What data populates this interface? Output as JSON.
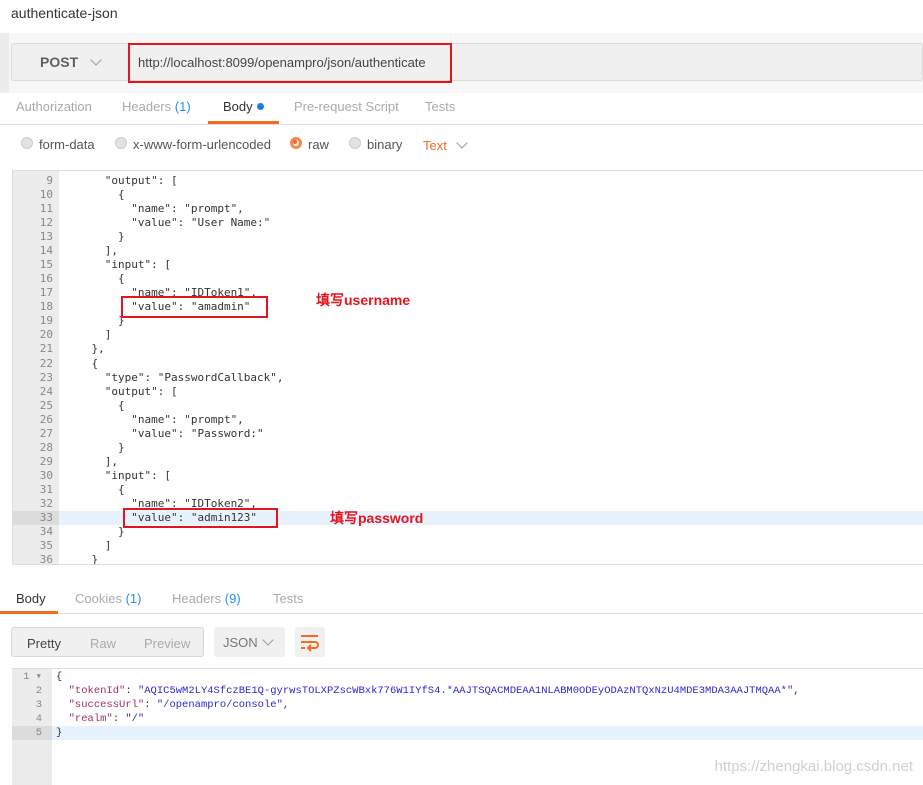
{
  "title": "authenticate-json",
  "request": {
    "method": "POST",
    "url": "http://localhost:8099/openampro/json/authenticate"
  },
  "tabs": [
    {
      "label": "Authorization"
    },
    {
      "label": "Headers",
      "count": "(1)"
    },
    {
      "label": "Body",
      "active": true
    },
    {
      "label": "Pre-request Script"
    },
    {
      "label": "Tests"
    }
  ],
  "body_modes": [
    {
      "label": "form-data"
    },
    {
      "label": "x-www-form-urlencoded"
    },
    {
      "label": "raw",
      "selected": true
    },
    {
      "label": "binary"
    }
  ],
  "body_type": "Text",
  "editor_lines": [
    {
      "n": "9",
      "t": "      \"output\": ["
    },
    {
      "n": "10",
      "t": "        {"
    },
    {
      "n": "11",
      "t": "          \"name\": \"prompt\","
    },
    {
      "n": "12",
      "t": "          \"value\": \"User Name:\""
    },
    {
      "n": "13",
      "t": "        }"
    },
    {
      "n": "14",
      "t": "      ],"
    },
    {
      "n": "15",
      "t": "      \"input\": ["
    },
    {
      "n": "16",
      "t": "        {"
    },
    {
      "n": "17",
      "t": "          \"name\": \"IDToken1\","
    },
    {
      "n": "18",
      "t": "          \"value\": \"amadmin\""
    },
    {
      "n": "19",
      "t": "        }"
    },
    {
      "n": "20",
      "t": "      ]"
    },
    {
      "n": "21",
      "t": "    },"
    },
    {
      "n": "22",
      "t": "    {"
    },
    {
      "n": "23",
      "t": "      \"type\": \"PasswordCallback\","
    },
    {
      "n": "24",
      "t": "      \"output\": ["
    },
    {
      "n": "25",
      "t": "        {"
    },
    {
      "n": "26",
      "t": "          \"name\": \"prompt\","
    },
    {
      "n": "27",
      "t": "          \"value\": \"Password:\""
    },
    {
      "n": "28",
      "t": "        }"
    },
    {
      "n": "29",
      "t": "      ],"
    },
    {
      "n": "30",
      "t": "      \"input\": ["
    },
    {
      "n": "31",
      "t": "        {"
    },
    {
      "n": "32",
      "t": "          \"name\": \"IDToken2\","
    },
    {
      "n": "33",
      "t": "          \"value\": \"admin123\""
    },
    {
      "n": "34",
      "t": "        }"
    },
    {
      "n": "35",
      "t": "      ]"
    },
    {
      "n": "36",
      "t": "    }"
    }
  ],
  "annotations": {
    "username": "填写username",
    "password": "填写password"
  },
  "response_tabs": [
    {
      "label": "Body",
      "active": true
    },
    {
      "label": "Cookies",
      "count": "(1)"
    },
    {
      "label": "Headers",
      "count": "(9)"
    },
    {
      "label": "Tests"
    }
  ],
  "view_modes": [
    "Pretty",
    "Raw",
    "Preview"
  ],
  "response_format": "JSON",
  "response": {
    "open": "{",
    "tokenId_key": "\"tokenId\"",
    "tokenId": "\"AQIC5wM2LY4SfczBE1Q-gyrwsTOLXPZscWBxk776W1IYfS4.*AAJTSQACMDEAA1NLABM0ODEyODAzNTQxNzU4MDE3MDA3AAJTMQAA*\"",
    "successUrl_key": "\"successUrl\"",
    "successUrl": "\"/openampro/console\"",
    "realm_key": "\"realm\"",
    "realm": "\"/\"",
    "close": "}"
  },
  "watermark": "https://zhengkai.blog.csdn.net",
  "colors": {
    "accent": "#f26b21",
    "count_blue": "#2d8ee8",
    "annotation_red": "#e5141f"
  }
}
